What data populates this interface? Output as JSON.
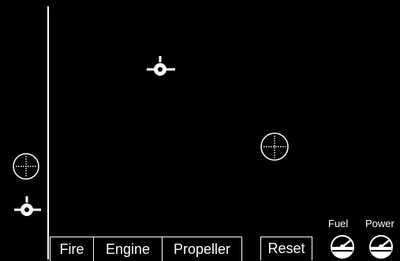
{
  "controls": {
    "fire_label": "Fire",
    "engine_label": "Engine",
    "propeller_label": "Propeller",
    "reset_label": "Reset"
  },
  "gauges": {
    "fuel_label": "Fuel",
    "power_label": "Power"
  },
  "icons": {
    "player_ship": "ship-icon",
    "enemy_ship": "enemy-ship-icon",
    "target": "crosshair-target-icon",
    "gauge": "gauge-dial-icon"
  },
  "colors": {
    "background": "#000000",
    "foreground": "#ffffff"
  }
}
